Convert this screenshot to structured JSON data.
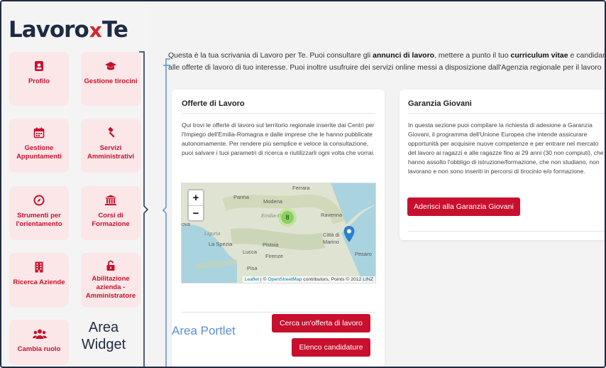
{
  "brand": {
    "prefix": "Lavoro",
    "x": "x",
    "suffix": "Te"
  },
  "sidebar": {
    "tiles": [
      {
        "label": "Profilo",
        "icon": "person-badge-icon"
      },
      {
        "label": "Gestione tirocini",
        "icon": "graduation-cap-icon"
      },
      {
        "label": "Gestione Appuntamenti",
        "icon": "calendar-icon"
      },
      {
        "label": "Servizi Amministrativi",
        "icon": "gavel-icon"
      },
      {
        "label": "Strumenti per l'orientamento",
        "icon": "compass-icon"
      },
      {
        "label": "Corsi di Formazione",
        "icon": "institution-icon"
      },
      {
        "label": "Ricerca Aziende",
        "icon": "building-icon"
      },
      {
        "label": "Abilitazione azienda - Amministratore",
        "icon": "unlock-icon"
      },
      {
        "label": "Cambia ruolo",
        "icon": "users-icon"
      }
    ],
    "area_label_1": "Area",
    "area_label_2": "Widget"
  },
  "intro": {
    "line1_a": "Questa è la tua scrivania di Lavoro per Te. Puoi consultare gli ",
    "line1_b": "annunci di lavoro",
    "line1_c": ", mettere a punto il tuo ",
    "line1_d": "curriculum vitae",
    "line1_e": " e candidart",
    "line2": "alle offerte di lavoro di tuo interesse. Puoi inoltre usufruire dei servizi online messi a disposizione dall'Agenzia regionale per il lavoro"
  },
  "offerte": {
    "title": "Offerte di Lavoro",
    "text": "Qui trovi le offerte di lavoro sul territorio regionale inserite dai Centri per l'Impiego dell'Emilia-Romagna e dalle imprese che le hanno pubblicate autonomamente. Per rendere più semplice e veloce la consultazione, puoi salvare i tuoi parametri di ricerca e riutilizzarli ogni volta che vorrai.",
    "map": {
      "zoom_in": "+",
      "zoom_out": "−",
      "cluster_count": "8",
      "places": {
        "ferrara": "Ferrara",
        "parma": "Parma",
        "modena": "Modena",
        "emilia": "Emilia-R",
        "ravenna": "Ravenna",
        "liguria": "Liguria",
        "laspezia": "La Spezia",
        "pistoia": "Pistoia",
        "lucca": "Lucca",
        "firenze": "Firenze",
        "citta": "Città di",
        "marino": "Marino",
        "pesaro": "Pesaro",
        "pisa": "Pisa",
        "ova": "ova"
      },
      "attrib_leaflet": "Leaflet",
      "attrib_sep": " | © ",
      "attrib_osm": "OpenStreetMap",
      "attrib_rest": " contributors, Points © 2012 LINZ"
    },
    "btn_cerca": "Cerca un'offerta di lavoro",
    "btn_elenco": "Elenco candidature",
    "area_label": "Area Portlet"
  },
  "garanzia": {
    "title": "Garanzia Giovani",
    "text": "In questa sezione puoi compilare la richiesta di adesione a Garanzia Giovani, il programma dell'Unione Europea che intende assicurare opportunità per acquisire nuove competenze e per entrare nel mercato del lavoro ai ragazzi e alle ragazze fino ai 29 anni (30 non compiuti), che hanno assolto l'obbligo di istruzione/formazione, che non studiano, non lavorano e non sono inseriti in percorsi di tirocinio e/o formazione.",
    "btn": "Aderisci alla Garanzia Giovani"
  },
  "colors": {
    "accent": "#c8102e",
    "tile_bg": "#fbe7e7",
    "navy": "#1f2a44",
    "label_blue": "#5b8fd6"
  }
}
